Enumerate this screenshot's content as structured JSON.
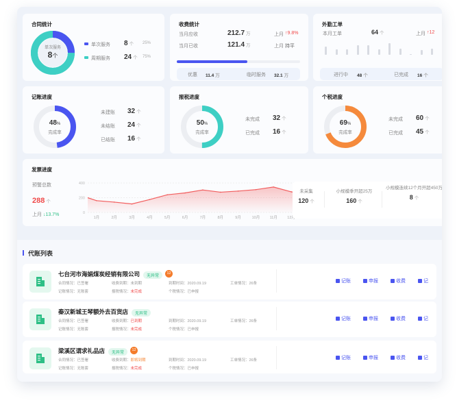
{
  "contract": {
    "title": "合同统计",
    "center_label": "单次服务",
    "center_value": "8",
    "center_unit": "个",
    "items": [
      {
        "label": "单次服务",
        "value": "8",
        "unit": "个",
        "pct": "25%",
        "color": "#4a55f0"
      },
      {
        "label": "周期服务",
        "value": "24",
        "unit": "个",
        "pct": "75%",
        "color": "#3ecfc4"
      }
    ],
    "percent": 25
  },
  "fees": {
    "title": "收费统计",
    "rows": [
      {
        "label": "当月应收",
        "value": "212.7",
        "unit": "万",
        "cmp_label": "上月",
        "cmp_value": "9.8%",
        "trend": "up"
      },
      {
        "label": "当月已收",
        "value": "121.4",
        "unit": "万",
        "cmp_label": "上月",
        "cmp_value": "持平",
        "trend": "flat"
      }
    ],
    "progress": 57,
    "discount_label": "优惠",
    "discount_value": "11.4",
    "discount_unit": "万",
    "temp_label": "临时服务",
    "temp_value": "32.1",
    "temp_unit": "万"
  },
  "field": {
    "title": "外勤工单",
    "month_label": "本月工单",
    "month_value": "64",
    "unit": "个",
    "cmp_label": "上月",
    "cmp_value": "12",
    "bars": [
      14,
      9,
      10,
      16,
      16,
      10,
      20,
      11,
      1,
      8,
      11
    ],
    "progress_label": "进行中",
    "progress_value": "48",
    "done_label": "已完成",
    "done_value": "16"
  },
  "bookkeeping": {
    "title": "记账进度",
    "percent": 48,
    "pct_text": "48",
    "pct_sign": "%",
    "rate_label": "完成率",
    "color": "#4a55f0",
    "items": [
      {
        "label": "未建账",
        "value": "32",
        "unit": "个"
      },
      {
        "label": "未结账",
        "value": "24",
        "unit": "个"
      },
      {
        "label": "已结账",
        "value": "16",
        "unit": "个"
      }
    ]
  },
  "tax": {
    "title": "报税进度",
    "percent": 50,
    "pct_text": "50",
    "pct_sign": "%",
    "rate_label": "完成率",
    "color": "#3ecfc4",
    "items": [
      {
        "label": "未完成",
        "value": "32",
        "unit": "个"
      },
      {
        "label": "已完成",
        "value": "16",
        "unit": "个"
      }
    ]
  },
  "itax": {
    "title": "个税进度",
    "percent": 69,
    "pct_text": "69",
    "pct_sign": "%",
    "rate_label": "完成率",
    "color": "#f58a3c",
    "items": [
      {
        "label": "未完成",
        "value": "60",
        "unit": "个"
      },
      {
        "label": "已完成",
        "value": "45",
        "unit": "个"
      }
    ]
  },
  "invoice": {
    "title": "发票进度",
    "warn_label": "预警总数",
    "warn_value": "288",
    "warn_unit": "个",
    "cmp_label": "上月",
    "cmp_value": "13.7%",
    "stats": [
      {
        "label": "未采集",
        "value": "120",
        "unit": "个"
      },
      {
        "label": "小规模季开超25万",
        "value": "160",
        "unit": "个"
      },
      {
        "label": "小规模连续12个月开超450万",
        "value": "8",
        "unit": "个"
      }
    ]
  },
  "chart_data": {
    "type": "area",
    "x": [
      "1月",
      "2月",
      "3月",
      "4月",
      "5月",
      "6月",
      "7月",
      "8月",
      "9月",
      "10月",
      "11月",
      "12月"
    ],
    "values": [
      160,
      140,
      115,
      175,
      240,
      265,
      305,
      275,
      290,
      310,
      345,
      280
    ],
    "yticks": [
      "400",
      "200",
      "0"
    ],
    "ylim": [
      0,
      400
    ],
    "color": "#f25d5d",
    "grid": true
  },
  "list": {
    "title": "代账列表",
    "rows": [
      {
        "name": "七台河市海娟煤炭经销有限公司",
        "tag": "无异常",
        "badge": "12",
        "contract": "合同情况：已签署",
        "fee_label": "收费到期：",
        "fee": "未到期",
        "fee_color": "#999999",
        "due": "到期时间：2020.09.19",
        "orders": "工单情况：26条",
        "book": "记账情况：无账套",
        "tax_label": "报税情况：",
        "tax": "未完成",
        "itax": "个税情况：已申报"
      },
      {
        "name": "秦汉新城王琴额外去百货店",
        "tag": "无异常",
        "badge": "",
        "contract": "合同情况：已签署",
        "fee_label": "收费到期：",
        "fee": "已到期",
        "fee_color": "#f04a4a",
        "due": "到期时间：2020.09.19",
        "orders": "工单情况：26条",
        "book": "记账情况：无账套",
        "tax_label": "报税情况：",
        "tax": "未完成",
        "itax": "个税情况：已申报"
      },
      {
        "name": "梁溪区谓求礼品店",
        "tag": "无异常",
        "badge": "12",
        "contract": "合同情况：已签署",
        "fee_label": "收费到期：",
        "fee": "即将到期",
        "fee_color": "#f58a3c",
        "due": "到期时间：2020.09.19",
        "orders": "工单情况：26条",
        "book": "记账情况：无账套",
        "tax_label": "报税情况：",
        "tax": "未完成",
        "itax": "个税情况：已申报"
      }
    ],
    "actions": [
      "记账",
      "申报",
      "收费",
      "记"
    ]
  }
}
